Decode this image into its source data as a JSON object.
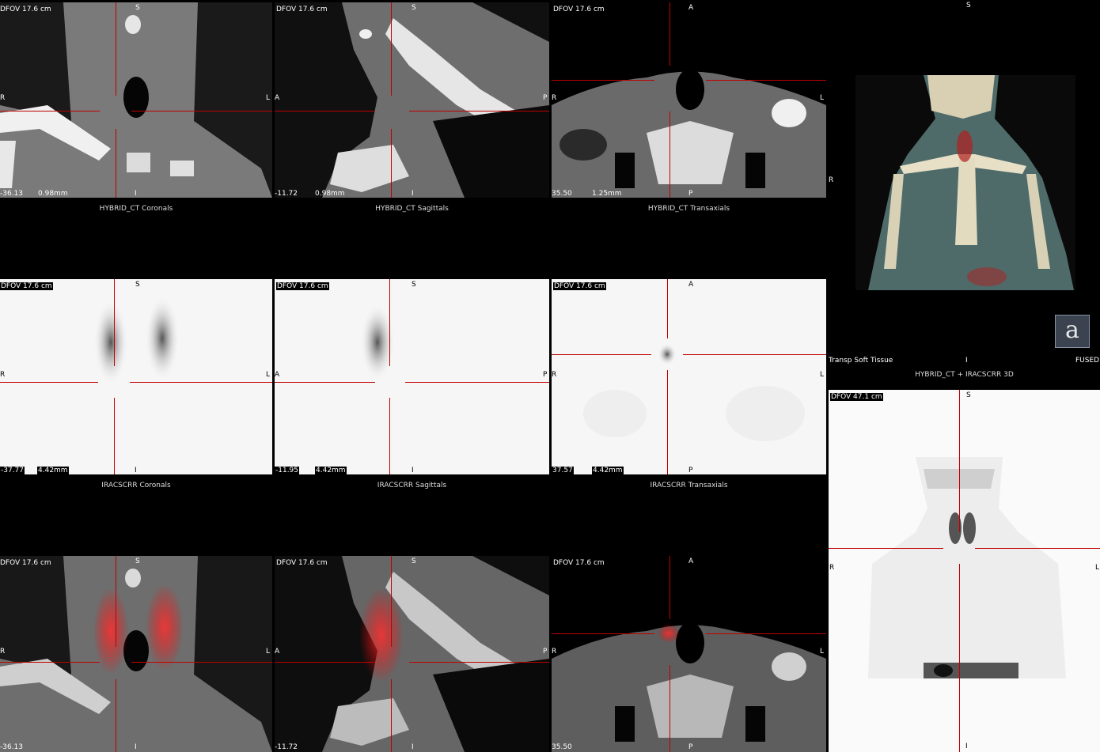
{
  "ct": {
    "coronal": {
      "dfov": "DFOV 17.6 cm",
      "top": "S",
      "left": "R",
      "right": "L",
      "bottom": "I",
      "pos": "-36.13",
      "thk": "0.98mm",
      "caption": "HYBRID_CT Coronals"
    },
    "sagittal": {
      "dfov": "DFOV 17.6 cm",
      "top": "S",
      "left": "A",
      "right": "P",
      "bottom": "I",
      "pos": "-11.72",
      "thk": "0.98mm",
      "caption": "HYBRID_CT Sagittals"
    },
    "transaxial": {
      "dfov": "DFOV 17.6 cm",
      "top": "A",
      "left": "R",
      "right": "L",
      "bottom": "P",
      "pos": "35.50",
      "thk": "1.25mm",
      "caption": "HYBRID_CT Transaxials"
    }
  },
  "nm": {
    "coronal": {
      "dfov": "DFOV 17.6 cm",
      "top": "S",
      "left": "R",
      "right": "L",
      "bottom": "I",
      "pos": "-37.77",
      "thk": "4.42mm",
      "caption": "IRACSCRR Coronals"
    },
    "sagittal": {
      "dfov": "DFOV 17.6 cm",
      "top": "S",
      "left": "A",
      "right": "P",
      "bottom": "I",
      "pos": "-11.95",
      "thk": "4.42mm",
      "caption": "IRACSCRR Sagittals"
    },
    "transaxial": {
      "dfov": "DFOV 17.6 cm",
      "top": "A",
      "left": "R",
      "right": "L",
      "bottom": "P",
      "pos": "37.57",
      "thk": "4.42mm",
      "caption": "IRACSCRR Transaxials"
    }
  },
  "fused": {
    "coronal": {
      "dfov": "DFOV 17.6 cm",
      "top": "S",
      "left": "R",
      "right": "L",
      "bottom": "I",
      "pos": "-36.13"
    },
    "sagittal": {
      "dfov": "DFOV 17.6 cm",
      "top": "S",
      "left": "A",
      "right": "P",
      "bottom": "I",
      "pos": "-11.72"
    },
    "transaxial": {
      "dfov": "DFOV 17.6 cm",
      "top": "A",
      "left": "R",
      "right": "L",
      "bottom": "P",
      "pos": "35.50"
    }
  },
  "vr3d": {
    "top": "S",
    "left": "R",
    "bottom": "I",
    "preset": "Transp Soft Tissue",
    "mode": "FUSED",
    "caption": "HYBRID_CT + IRACSCRR 3D",
    "badge": "a"
  },
  "mip": {
    "dfov": "DFOV 47.1 cm",
    "top": "S",
    "left": "R",
    "right": "L",
    "bottom": "I"
  },
  "colors": {
    "crosshair": "#c00000",
    "selection": "#7fd8e0",
    "background": "#000000"
  }
}
